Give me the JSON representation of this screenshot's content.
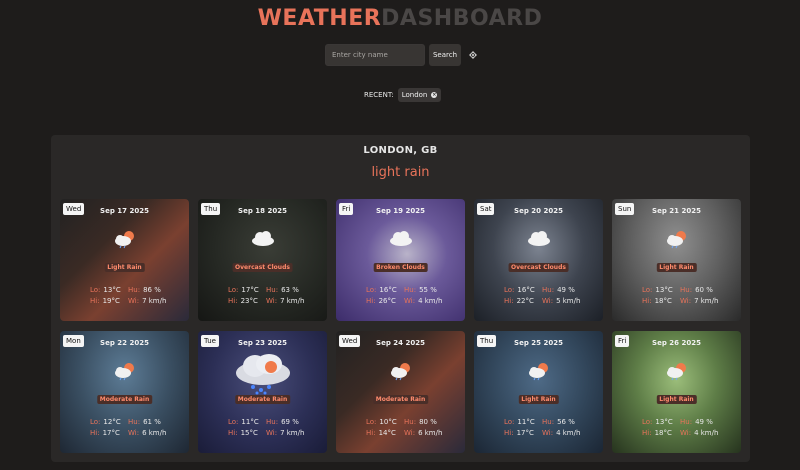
{
  "header": {
    "title_part1": "WEATHER",
    "title_part2": "DASHBOARD"
  },
  "search": {
    "placeholder": "Enter city name",
    "value": "",
    "button_label": "Search"
  },
  "recent": {
    "label": "RECENT:",
    "items": [
      {
        "label": "London",
        "remove_icon": "close-icon"
      }
    ]
  },
  "current": {
    "city": "LONDON, GB",
    "description": "light rain"
  },
  "colors": {
    "accent": "#e8735a",
    "background": "#1e1c1b",
    "panel": "#2a2827"
  },
  "forecast_labels": {
    "lo": "Lo:",
    "hi": "Hi:",
    "hu": "Hu:",
    "wi": "Wi:"
  },
  "forecast": [
    {
      "day": "Wed",
      "date": "Sep 17 2025",
      "condition": "Light Rain",
      "lo": "13°C",
      "hi": "19°C",
      "hu": "86 %",
      "wi": "7 km/h",
      "icon": "sun-cloud-rain-icon"
    },
    {
      "day": "Thu",
      "date": "Sep 18 2025",
      "condition": "Overcast Clouds",
      "lo": "17°C",
      "hi": "23°C",
      "hu": "63 %",
      "wi": "7 km/h",
      "icon": "cloud-icon"
    },
    {
      "day": "Fri",
      "date": "Sep 19 2025",
      "condition": "Broken Clouds",
      "lo": "16°C",
      "hi": "26°C",
      "hu": "55 %",
      "wi": "4 km/h",
      "icon": "cloud-icon"
    },
    {
      "day": "Sat",
      "date": "Sep 20 2025",
      "condition": "Overcast Clouds",
      "lo": "16°C",
      "hi": "22°C",
      "hu": "49 %",
      "wi": "5 km/h",
      "icon": "cloud-icon"
    },
    {
      "day": "Sun",
      "date": "Sep 21 2025",
      "condition": "Light Rain",
      "lo": "13°C",
      "hi": "18°C",
      "hu": "60 %",
      "wi": "7 km/h",
      "icon": "sun-cloud-rain-icon"
    },
    {
      "day": "Mon",
      "date": "Sep 22 2025",
      "condition": "Moderate Rain",
      "lo": "12°C",
      "hi": "17°C",
      "hu": "61 %",
      "wi": "6 km/h",
      "icon": "sun-cloud-rain-icon"
    },
    {
      "day": "Tue",
      "date": "Sep 23 2025",
      "condition": "Moderate Rain",
      "lo": "11°C",
      "hi": "15°C",
      "hu": "69 %",
      "wi": "7 km/h",
      "icon": "rain-cloud-icon"
    },
    {
      "day": "Wed",
      "date": "Sep 24 2025",
      "condition": "Moderate Rain",
      "lo": "10°C",
      "hi": "14°C",
      "hu": "80 %",
      "wi": "6 km/h",
      "icon": "sun-cloud-rain-icon"
    },
    {
      "day": "Thu",
      "date": "Sep 25 2025",
      "condition": "Light Rain",
      "lo": "11°C",
      "hi": "17°C",
      "hu": "56 %",
      "wi": "4 km/h",
      "icon": "sun-cloud-rain-icon"
    },
    {
      "day": "Fri",
      "date": "Sep 26 2025",
      "condition": "Light Rain",
      "lo": "13°C",
      "hi": "18°C",
      "hu": "49 %",
      "wi": "4 km/h",
      "icon": "sun-cloud-rain-icon"
    }
  ]
}
